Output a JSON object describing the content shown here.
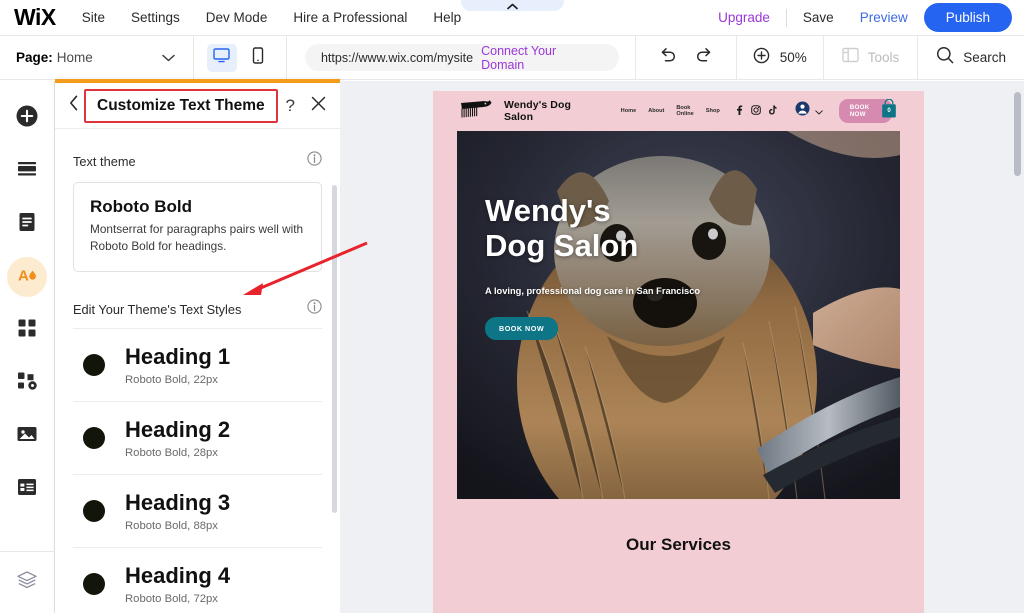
{
  "topbar": {
    "logo": "WiX",
    "menu": [
      "Site",
      "Settings",
      "Dev Mode",
      "Hire a Professional",
      "Help"
    ],
    "upgrade": "Upgrade",
    "save": "Save",
    "preview": "Preview",
    "publish": "Publish",
    "collapse_icon": "chevron-up-icon"
  },
  "toolbar": {
    "page_label": "Page:",
    "page_value": "Home",
    "page_chevron": "chevron-down-icon",
    "device_desktop": "desktop-icon",
    "device_mobile": "mobile-icon",
    "url": "https://www.wix.com/mysite",
    "connect_domain": "Connect Your Domain",
    "undo": "undo-icon",
    "redo": "redo-icon",
    "zoom_icon": "zoom-in-icon",
    "zoom_value": "50%",
    "tools_icon": "panels-icon",
    "tools_label": "Tools",
    "search_icon": "search-icon",
    "search_label": "Search"
  },
  "rail": {
    "items": [
      {
        "name": "add-elements",
        "icon": "plus-circle-icon",
        "active": false
      },
      {
        "name": "add-section",
        "icon": "sections-icon",
        "active": false
      },
      {
        "name": "pages-menu",
        "icon": "pages-icon",
        "active": false
      },
      {
        "name": "site-design",
        "icon": "theme-droplet-icon",
        "active": true
      },
      {
        "name": "app-market",
        "icon": "apps-grid-icon",
        "active": false
      },
      {
        "name": "my-business",
        "icon": "add-ons-icon",
        "active": false
      },
      {
        "name": "media",
        "icon": "image-icon",
        "active": false
      },
      {
        "name": "content-manager",
        "icon": "table-icon",
        "active": false
      }
    ],
    "bottom": {
      "name": "layers",
      "icon": "layers-icon"
    }
  },
  "panel": {
    "back_icon": "chevron-left-icon",
    "title": "Customize Text Theme",
    "help_icon": "question-mark-icon",
    "close_icon": "close-x-icon",
    "text_theme_label": "Text theme",
    "text_theme_info": "info-icon",
    "theme_card": {
      "name": "Roboto Bold",
      "description": "Montserrat for paragraphs pairs well with Roboto Bold for headings."
    },
    "styles_label": "Edit Your Theme's Text Styles",
    "styles_info": "info-icon",
    "styles": [
      {
        "name": "Heading 1",
        "meta": "Roboto Bold, 22px",
        "swatch": "#121509"
      },
      {
        "name": "Heading 2",
        "meta": "Roboto Bold, 28px",
        "swatch": "#121509"
      },
      {
        "name": "Heading 3",
        "meta": "Roboto Bold, 88px",
        "swatch": "#121509"
      },
      {
        "name": "Heading 4",
        "meta": "Roboto Bold, 72px",
        "swatch": "#121509"
      }
    ]
  },
  "site": {
    "brand": "Wendy's Dog Salon",
    "logo_icon": "dog-logo-icon",
    "nav": [
      "Home",
      "About",
      "Book Online",
      "Shop"
    ],
    "social": [
      "facebook-icon",
      "instagram-icon",
      "tiktok-icon"
    ],
    "account_icon": "account-avatar-icon",
    "account_chevron": "chevron-down-icon",
    "book_now": "BOOK NOW",
    "cart_icon": "shopping-bag-icon",
    "cart_count": "0",
    "hero_line1": "Wendy's",
    "hero_line2": "Dog Salon",
    "hero_subtitle": "A loving, professional dog care in San Francisco",
    "hero_button": "BOOK NOW",
    "services_title": "Our Services"
  },
  "colors": {
    "brand_blue": "#2564f0",
    "upgrade_purple": "#9b37d9",
    "accent_orange": "#f59b1b",
    "annotation_red": "#e0343c",
    "site_pink": "#f2ced4",
    "book_pink": "#d68ab0",
    "cart_teal": "#0d7585"
  }
}
